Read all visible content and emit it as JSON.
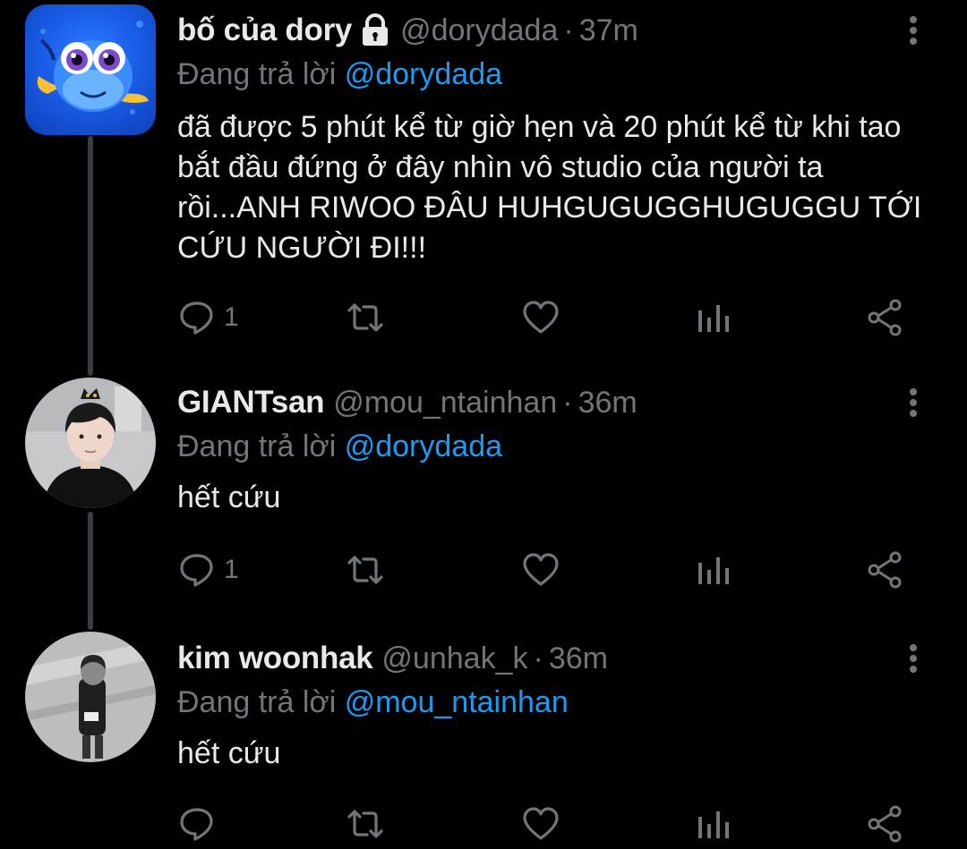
{
  "colors": {
    "background": "#000000",
    "text_primary": "#e7e9ea",
    "text_secondary": "#71767b",
    "mention": "#1d9bf0",
    "thread_line": "#3a3d41"
  },
  "tweets": [
    {
      "display_name": "bố của dory",
      "protected": true,
      "handle": "@dorydada",
      "separator": "·",
      "time": "37m",
      "reply_prefix": "Đang trả lời",
      "reply_to": "@dorydada",
      "text": "đã được 5 phút kể từ giờ hẹn và 20 phút kể từ khi tao bắt đầu đứng ở đây nhìn vô studio của người ta rồi...ANH RIWOO ĐÂU HUHGUGUGGHUGUGGU TỚI CỨU NGƯỜI ĐI!!!",
      "reply_count": "1",
      "avatar_icon": "fish-avatar-icon"
    },
    {
      "display_name": "GIANTsan",
      "protected": false,
      "handle": "@mou_ntainhan",
      "separator": "·",
      "time": "36m",
      "reply_prefix": "Đang trả lời",
      "reply_to": "@dorydada",
      "text": "hết cứu",
      "reply_count": "1",
      "avatar_icon": "person-avatar-icon"
    },
    {
      "display_name": "kim woonhak",
      "protected": false,
      "handle": "@unhak_k",
      "separator": "·",
      "time": "36m",
      "reply_prefix": "Đang trả lời",
      "reply_to": "@mou_ntainhan",
      "text": "hết cứu",
      "reply_count": "",
      "avatar_icon": "person-avatar-icon"
    }
  ],
  "action_icons": [
    "reply-icon",
    "retweet-icon",
    "like-icon",
    "analytics-icon",
    "share-icon"
  ]
}
